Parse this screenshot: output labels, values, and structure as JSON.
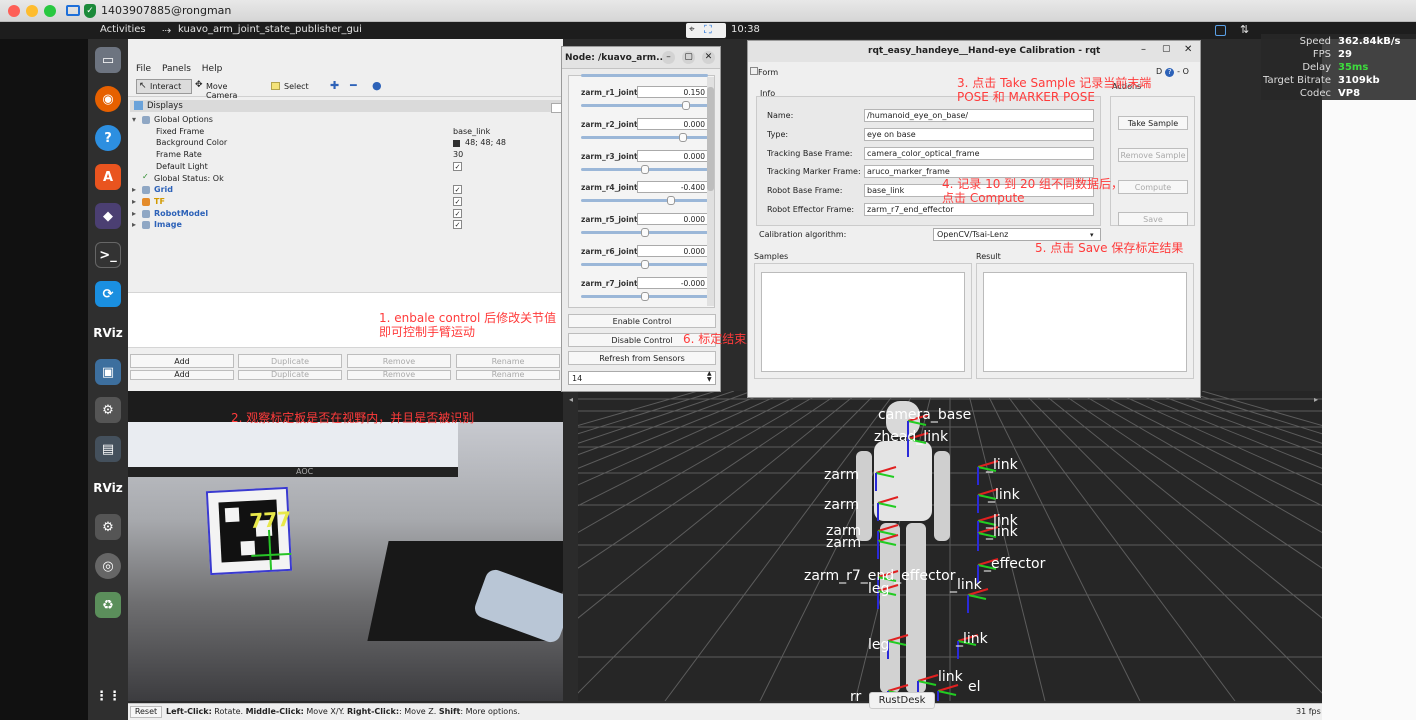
{
  "mac_bar": {
    "title": "1403907885@rongman"
  },
  "gnome_bar": {
    "activities": "Activities",
    "app_name": "kuavo_arm_joint_state_publisher_gui",
    "clock": "10:38"
  },
  "rviz": {
    "menu": [
      "File",
      "Panels",
      "Help"
    ],
    "tools": [
      "Interact",
      "Move Camera",
      "Select"
    ],
    "displays_title": "Displays",
    "tree": [
      {
        "label": "Global Options",
        "value": "",
        "indent": 0
      },
      {
        "label": "Fixed Frame",
        "value": "base_link",
        "indent": 1
      },
      {
        "label": "Background Color",
        "value": "48; 48; 48",
        "indent": 1
      },
      {
        "label": "Frame Rate",
        "value": "30",
        "indent": 1
      },
      {
        "label": "Default Light",
        "value": "✓",
        "indent": 1
      },
      {
        "label": "Global Status: Ok",
        "value": "",
        "indent": 0
      },
      {
        "label": "Grid",
        "value": "✓",
        "indent": 0
      },
      {
        "label": "TF",
        "value": "✓",
        "indent": 0
      },
      {
        "label": "RobotModel",
        "value": "✓",
        "indent": 0
      },
      {
        "label": "Image",
        "value": "✓",
        "indent": 0
      }
    ],
    "buttons": [
      "Add",
      "Duplicate",
      "Remove",
      "Rename"
    ],
    "buttons2": [
      "Add",
      "Duplicate",
      "Remove",
      "Rename"
    ],
    "annotation1": "1. enbale control 后修改关节值\n即可控制手臂运动",
    "annotation2": "2. 观察标定板是否在视野内，并且是否被识别"
  },
  "camera": {
    "marker_label": "777",
    "brand": "AOC"
  },
  "node": {
    "title": "Node: /kuavo_arm...",
    "joints": [
      {
        "name": "zarm_r1_joint",
        "value": "0.150",
        "pos": 0.85
      },
      {
        "name": "zarm_r2_joint",
        "value": "0.000",
        "pos": 0.82
      },
      {
        "name": "zarm_r3_joint",
        "value": "0.000",
        "pos": 0.5
      },
      {
        "name": "zarm_r4_joint",
        "value": "-0.400",
        "pos": 0.72
      },
      {
        "name": "zarm_r5_joint",
        "value": "0.000",
        "pos": 0.5
      },
      {
        "name": "zarm_r6_joint",
        "value": "0.000",
        "pos": 0.5
      },
      {
        "name": "zarm_r7_joint",
        "value": "-0.000",
        "pos": 0.5
      }
    ],
    "enable": "Enable Control",
    "disable": "Disable Control",
    "refresh": "Refresh from Sensors",
    "spin": "14",
    "annotation6": "6. 标定结束后点击 Disable Control"
  },
  "rqt": {
    "title": "rqt_easy_handeye__Hand-eye Calibration - rqt",
    "form": "Form",
    "info": "Info",
    "actions": "Actions",
    "fields": [
      {
        "label": "Name:",
        "value": "/humanoid_eye_on_base/"
      },
      {
        "label": "Type:",
        "value": "eye on base"
      },
      {
        "label": "Tracking Base Frame:",
        "value": "camera_color_optical_frame"
      },
      {
        "label": "Tracking Marker Frame:",
        "value": "aruco_marker_frame"
      },
      {
        "label": "Robot Base Frame:",
        "value": "base_link"
      },
      {
        "label": "Robot Effector Frame:",
        "value": "zarm_r7_end_effector"
      }
    ],
    "algo_label": "Calibration algorithm:",
    "algo_value": "OpenCV/Tsai-Lenz",
    "take_sample": "Take Sample",
    "remove_sample": "Remove Sample",
    "compute": "Compute",
    "save": "Save",
    "samples": "Samples",
    "result": "Result",
    "annotation3": "3. 点击 Take Sample 记录当前末端\nPOSE 和 MARKER POSE",
    "annotation4": "4. 记录 10 到 20 组不同数据后，\n点击 Compute",
    "annotation5": "5. 点击 Save 保存标定结果"
  },
  "stats": [
    {
      "k": "Speed",
      "v": "362.84kB/s",
      "c": "#ffffff"
    },
    {
      "k": "FPS",
      "v": "29",
      "c": "#ffffff"
    },
    {
      "k": "Delay",
      "v": "35ms",
      "c": "#3ddc3d"
    },
    {
      "k": "Target Bitrate",
      "v": "3109kb",
      "c": "#ffffff"
    },
    {
      "k": "Codec",
      "v": "VP8",
      "c": "#ffffff"
    }
  ],
  "tf_labels": [
    "camera_base",
    "zhead_link",
    "_link",
    "zarm",
    "_link",
    "zarm",
    "_link",
    "zarm",
    "_link",
    "zarm",
    "zarm_r7_end_effector",
    "_effector",
    "leg",
    "_link",
    "leg",
    "_link",
    "el",
    "rr",
    "link"
  ],
  "status": {
    "reset": "Reset",
    "help_b1": "Left-Click:",
    "help_t1": " Rotate. ",
    "help_b2": "Middle-Click:",
    "help_t2": " Move X/Y. ",
    "help_b3": "Right-Click:",
    "help_t3": ": Move Z. ",
    "help_b4": "Shift",
    "help_t4": ": More options.",
    "fps": "31 fps",
    "rustdesk": "RustDesk"
  }
}
